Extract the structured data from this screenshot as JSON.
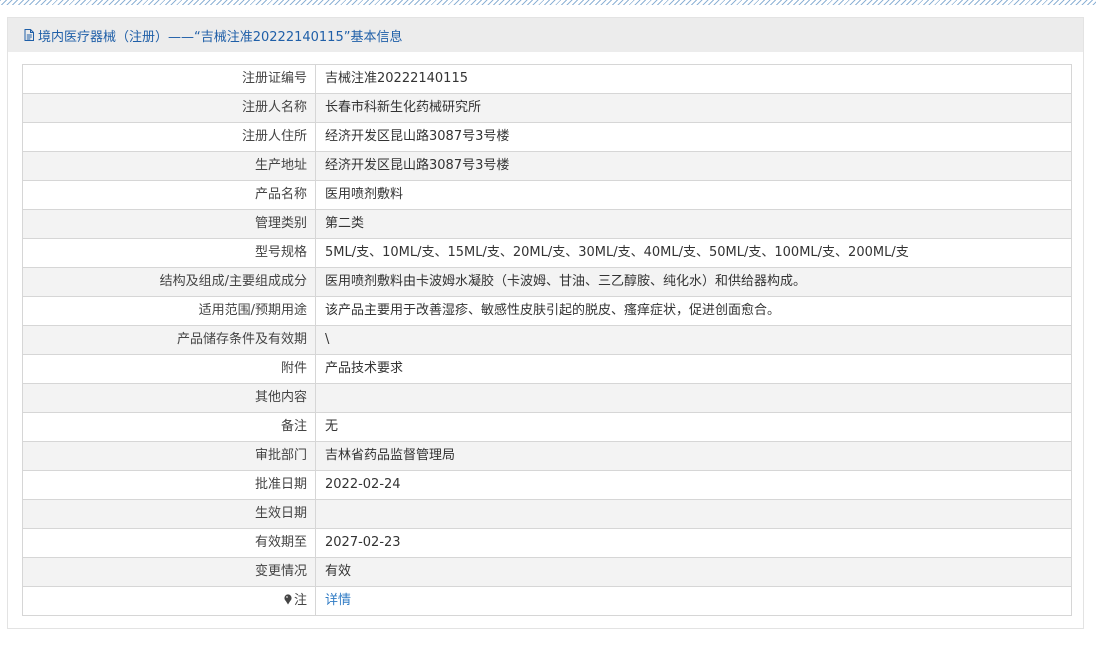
{
  "header": {
    "title": "境内医疗器械（注册）——“吉械注准20222140115”基本信息",
    "icon": "document-icon"
  },
  "rows": [
    {
      "label": "注册证编号",
      "value": "吉械注准20222140115"
    },
    {
      "label": "注册人名称",
      "value": "长春市科新生化药械研究所"
    },
    {
      "label": "注册人住所",
      "value": "经济开发区昆山路3087号3号楼"
    },
    {
      "label": "生产地址",
      "value": "经济开发区昆山路3087号3号楼"
    },
    {
      "label": "产品名称",
      "value": "医用喷剂敷料"
    },
    {
      "label": "管理类别",
      "value": "第二类"
    },
    {
      "label": "型号规格",
      "value": "5ML/支、10ML/支、15ML/支、20ML/支、30ML/支、40ML/支、50ML/支、100ML/支、200ML/支"
    },
    {
      "label": "结构及组成/主要组成成分",
      "value": "医用喷剂敷料由卡波姆水凝胶（卡波姆、甘油、三乙醇胺、纯化水）和供给器构成。"
    },
    {
      "label": "适用范围/预期用途",
      "value": "该产品主要用于改善湿疹、敏感性皮肤引起的脱皮、瘙痒症状，促进创面愈合。"
    },
    {
      "label": "产品储存条件及有效期",
      "value": "\\"
    },
    {
      "label": "附件",
      "value": "产品技术要求"
    },
    {
      "label": "其他内容",
      "value": ""
    },
    {
      "label": "备注",
      "value": "无"
    },
    {
      "label": "审批部门",
      "value": "吉林省药品监督管理局"
    },
    {
      "label": "批准日期",
      "value": "2022-02-24"
    },
    {
      "label": "生效日期",
      "value": ""
    },
    {
      "label": "有效期至",
      "value": "2027-02-23"
    },
    {
      "label": "变更情况",
      "value": "有效"
    }
  ],
  "note": {
    "icon": "location-pin-icon",
    "label": "注",
    "link_text": "详情"
  },
  "colors": {
    "header_text": "#1f5fa8",
    "link": "#2f7bc4"
  }
}
